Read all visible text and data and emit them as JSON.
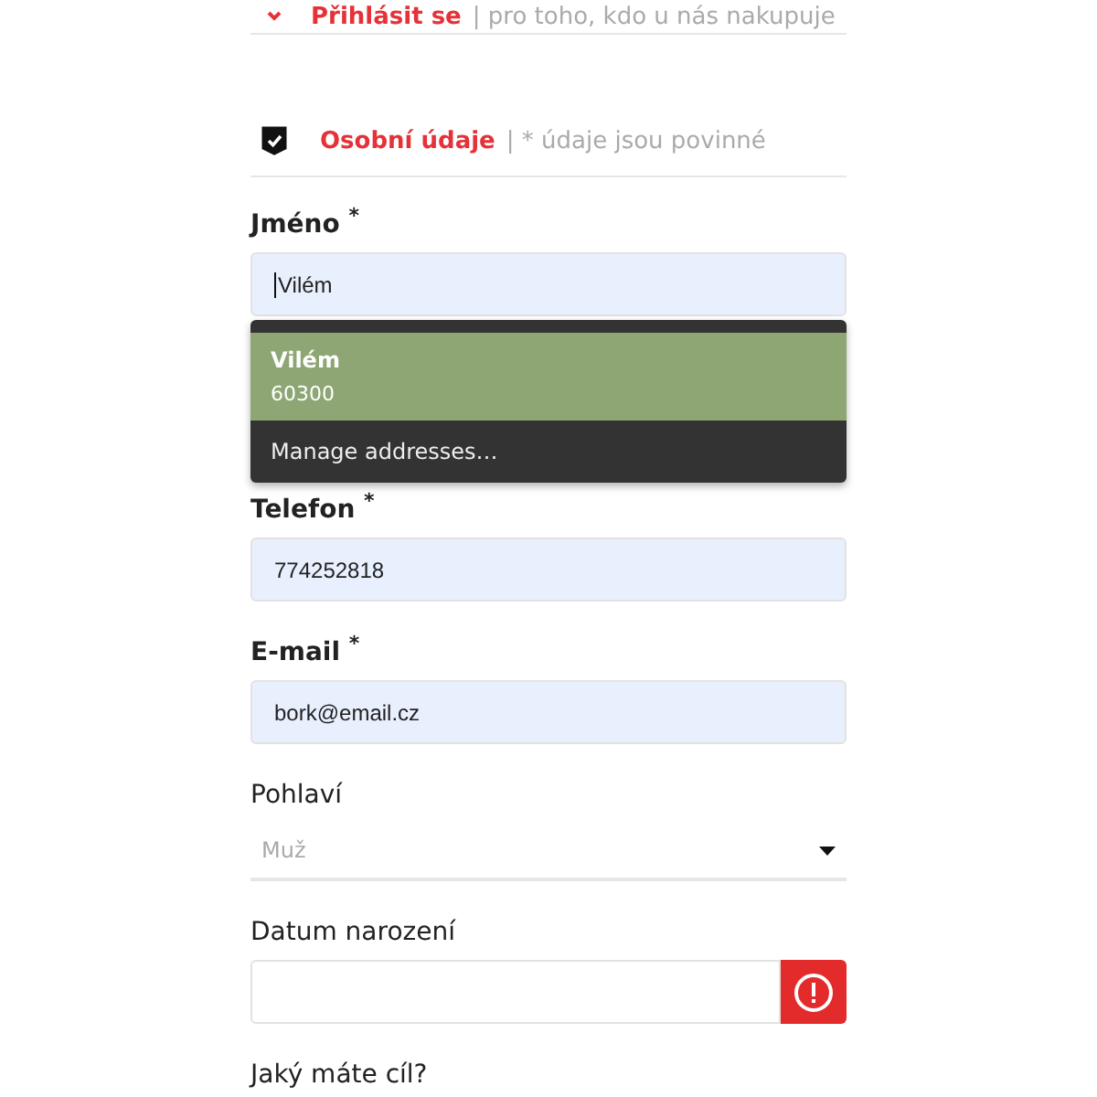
{
  "login_row": {
    "title": "Přihlásit se",
    "note": "| pro toho, kdo u nás nakupuje"
  },
  "section": {
    "title": "Osobní údaje",
    "note": "| * údaje jsou povinné",
    "checked": true
  },
  "name_field": {
    "label": "Jméno",
    "required_mark": "*",
    "value": "Vilém"
  },
  "autocomplete": {
    "items": [
      {
        "title": "Vilém",
        "subtitle": "60300",
        "selected": true
      }
    ],
    "manage": "Manage addresses…"
  },
  "fields": [
    {
      "kind": "text",
      "label": "Telefon",
      "required_mark": "*",
      "value": "774252818"
    },
    {
      "kind": "text",
      "label": "E-mail",
      "required_mark": "*",
      "value": "bork@email.cz"
    },
    {
      "kind": "select",
      "label": "Pohlaví",
      "placeholder": "Muž"
    },
    {
      "kind": "date",
      "label": "Datum narození",
      "error": true
    }
  ],
  "next_label": "Jaký máte cíl?"
}
